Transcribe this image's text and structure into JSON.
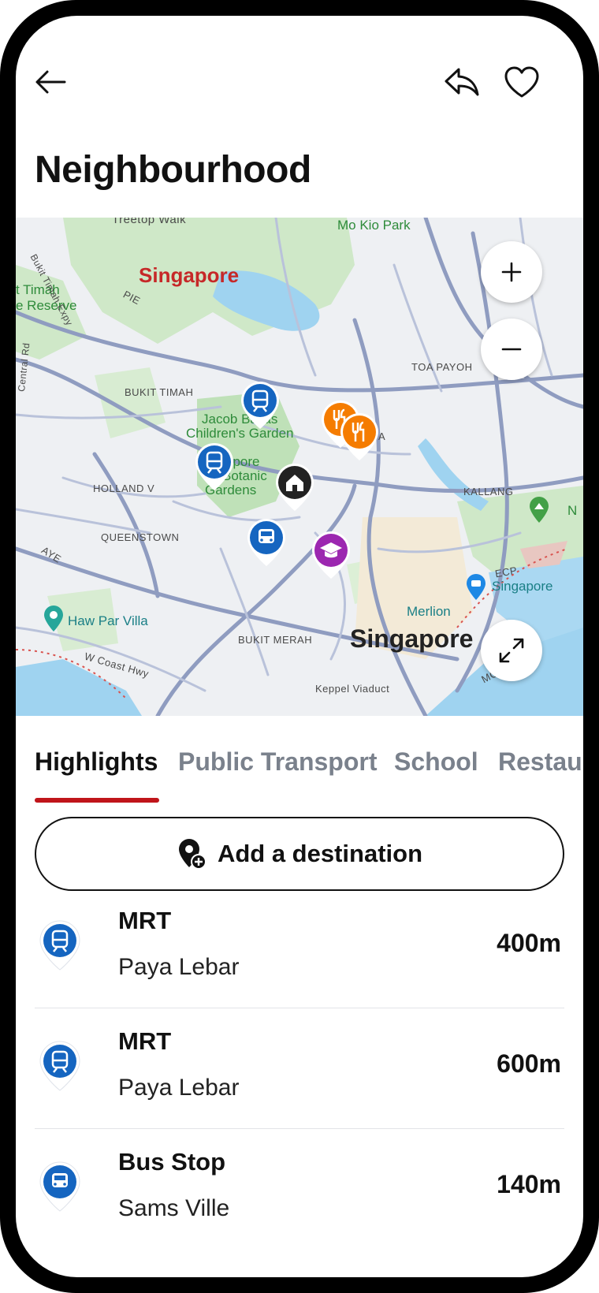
{
  "page": {
    "title": "Neighbourhood"
  },
  "colors": {
    "accent": "#c0151a",
    "transport_pin": "#1565c0",
    "restaurant_pin": "#f57c00",
    "school_pin": "#9c27b0",
    "home_pin": "#222222"
  },
  "icons": {
    "back": "arrow-left-icon",
    "share": "share-icon",
    "favorite": "heart-icon",
    "zoom_in": "plus-icon",
    "zoom_out": "minus-icon",
    "expand": "expand-icon",
    "destination": "location-add-icon"
  },
  "map": {
    "labels": {
      "treetop": "Treetop Walk",
      "mokio": "Mo Kio Park",
      "singapore_region": "Singapore",
      "bukit_timah_reserve_1": "t Timah",
      "bukit_timah_reserve_2": "e Reserve",
      "bukit_timah_expy": "Bukit Timah Expy",
      "pie": "PIE",
      "toa_payoh": "TOA PAYOH",
      "bukit_timah": "BUKIT TIMAH",
      "jacob_1": "Jacob Ballas",
      "jacob_2": "Children's Garden",
      "botanic_1": "Singapore",
      "botanic_2": "Botanic",
      "botanic_3": "Gardens",
      "holland": "HOLLAND V",
      "kallang": "KALLANG",
      "queenstown": "QUEENSTOWN",
      "aye": "AYE",
      "ecp": "ECP",
      "sg_flyer": "Singapore",
      "merlion": "Merlion",
      "haw_par": "Haw Par Villa",
      "bukit_merah": "BUKIT MERAH",
      "singapore_city": "Singapore",
      "wcoast": "W Coast Hwy",
      "keppel": "Keppel Viaduct",
      "mce": "MCE",
      "central_rd": "Central Rd",
      "area_a": "A",
      "edge_n": "N"
    }
  },
  "tabs": [
    {
      "label": "Highlights",
      "active": true
    },
    {
      "label": "Public Transport",
      "active": false
    },
    {
      "label": "School",
      "active": false
    },
    {
      "label": "Restaurants",
      "active": false
    }
  ],
  "destination_button": {
    "label": "Add a destination"
  },
  "list": [
    {
      "type": "MRT",
      "name": "Paya Lebar",
      "distance": "400m",
      "icon": "train-icon"
    },
    {
      "type": "MRT",
      "name": "Paya Lebar",
      "distance": "600m",
      "icon": "train-icon"
    },
    {
      "type": "Bus Stop",
      "name": "Sams Ville",
      "distance": "140m",
      "icon": "bus-icon"
    }
  ]
}
